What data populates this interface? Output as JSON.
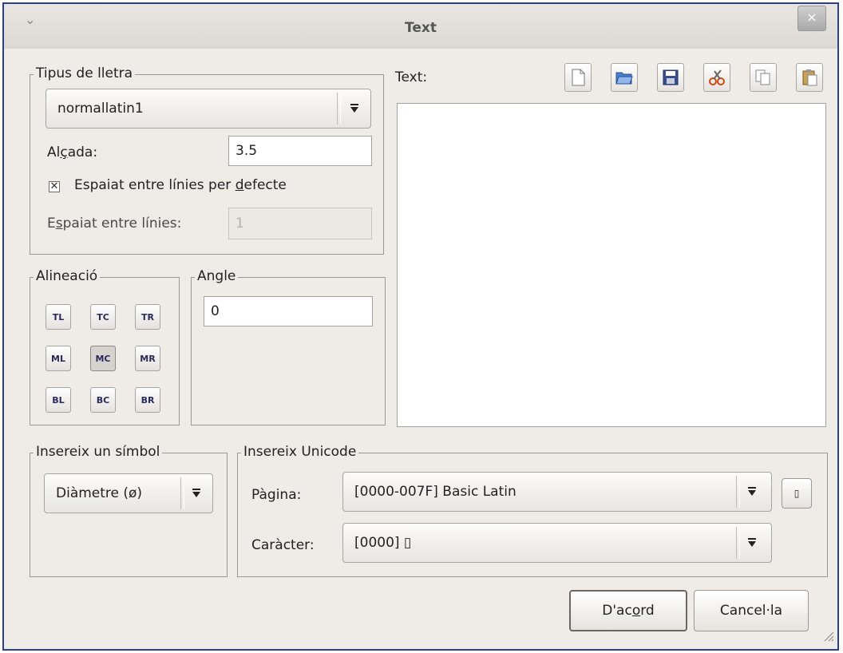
{
  "window": {
    "title": "Text",
    "menu_icon": "chevron-down-icon",
    "close_icon": "close-icon"
  },
  "font_group": {
    "legend": "Tipus de lletra",
    "font_value": "normallatin1",
    "height_label_pre": "Al",
    "height_label_u": "ç",
    "height_label_post": "ada:",
    "height_value": "3.5",
    "default_spacing_checked": true,
    "default_spacing_pre": "Espaiat entre línies per ",
    "default_spacing_u": "d",
    "default_spacing_post": "efecte",
    "line_spacing_pre": "E",
    "line_spacing_u": "s",
    "line_spacing_post": "paiat entre línies:",
    "line_spacing_value": "1"
  },
  "alignment": {
    "legend": "Alineació",
    "buttons": [
      "TL",
      "TC",
      "TR",
      "ML",
      "MC",
      "MR",
      "BL",
      "BC",
      "BR"
    ],
    "active": "MC"
  },
  "angle": {
    "legend": "Angle",
    "value": "0"
  },
  "text": {
    "label": "Text:",
    "content": "",
    "toolbar_icons": [
      "new-file-icon",
      "open-folder-icon",
      "save-icon",
      "cut-icon",
      "copy-icon",
      "paste-icon"
    ]
  },
  "symbol": {
    "legend": "Insereix un símbol",
    "value": "Diàmetre (ø)"
  },
  "unicode": {
    "legend": "Insereix Unicode",
    "page_label": "Pàgina:",
    "page_value": "[0000-007F] Basic Latin",
    "insert_glyph": "▯",
    "char_label": "Caràcter:",
    "char_value": "[0000] ▯"
  },
  "buttons": {
    "ok_pre": "D'ac",
    "ok_u": "o",
    "ok_post": "rd",
    "cancel": "Cancel·la"
  },
  "colors": {
    "window_border": "#2b3f9a",
    "dialog_bg": "#efebe7"
  }
}
